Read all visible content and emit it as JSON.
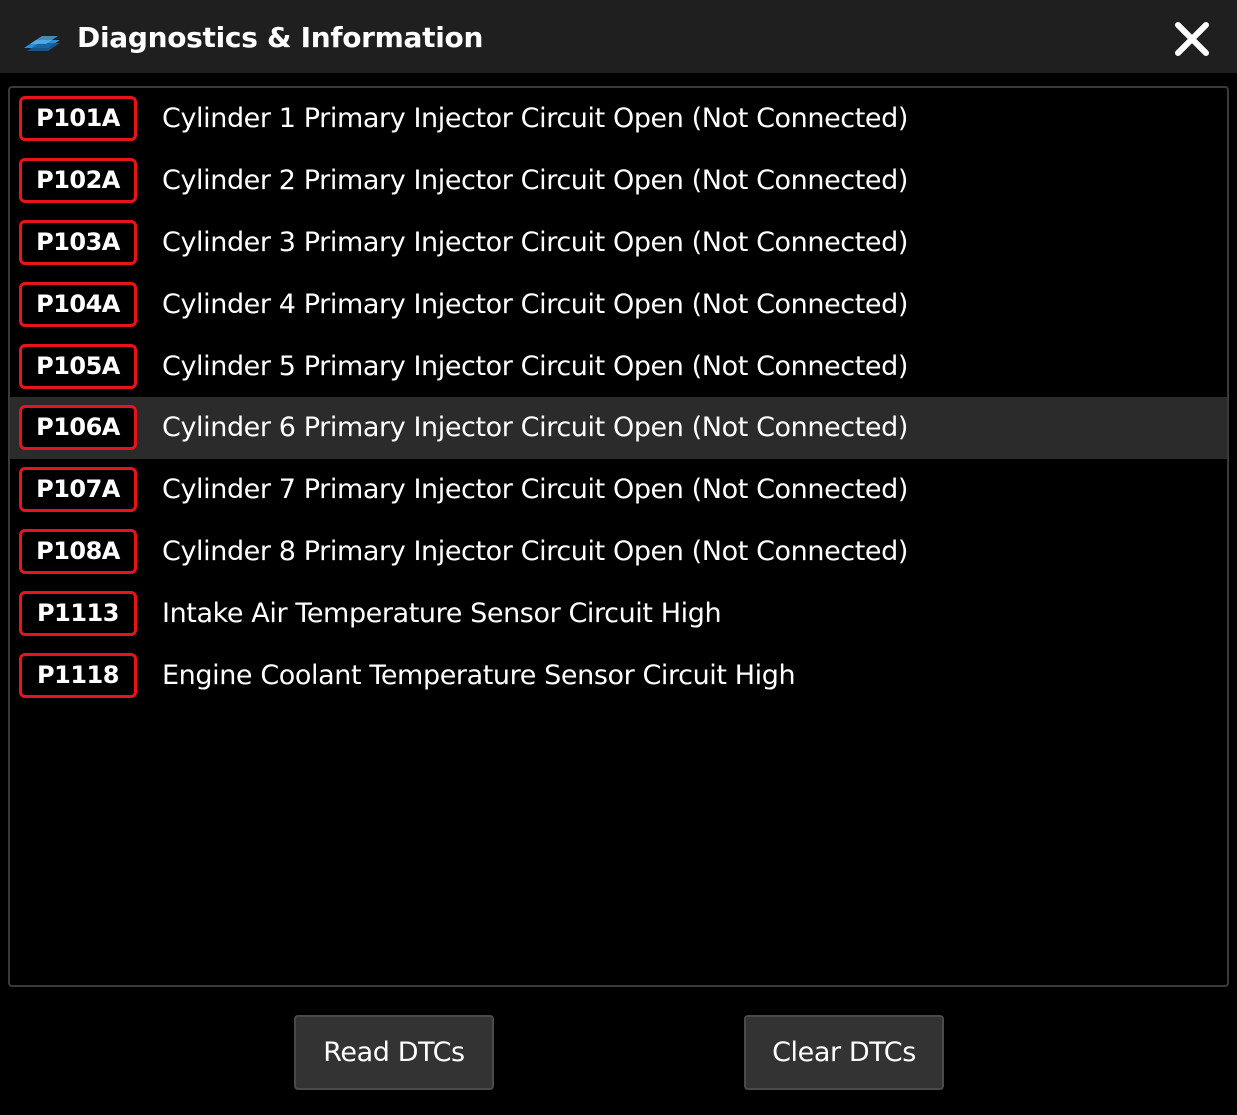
{
  "window": {
    "title": "Diagnostics & Information",
    "icon": "app-logo-icon",
    "close_icon": "close-icon"
  },
  "dtc_list": {
    "selected_index": 5,
    "items": [
      {
        "code": "P101A",
        "description": "Cylinder 1 Primary Injector Circuit Open (Not Connected)"
      },
      {
        "code": "P102A",
        "description": "Cylinder 2 Primary Injector Circuit Open (Not Connected)"
      },
      {
        "code": "P103A",
        "description": "Cylinder 3 Primary Injector Circuit Open (Not Connected)"
      },
      {
        "code": "P104A",
        "description": "Cylinder 4 Primary Injector Circuit Open (Not Connected)"
      },
      {
        "code": "P105A",
        "description": "Cylinder 5 Primary Injector Circuit Open (Not Connected)"
      },
      {
        "code": "P106A",
        "description": "Cylinder 6 Primary Injector Circuit Open (Not Connected)"
      },
      {
        "code": "P107A",
        "description": "Cylinder 7 Primary Injector Circuit Open (Not Connected)"
      },
      {
        "code": "P108A",
        "description": "Cylinder 8 Primary Injector Circuit Open (Not Connected)"
      },
      {
        "code": "P1113",
        "description": "Intake Air Temperature Sensor Circuit High"
      },
      {
        "code": "P1118",
        "description": "Engine Coolant Temperature Sensor Circuit High"
      }
    ]
  },
  "actions": {
    "read_label": "Read DTCs",
    "clear_label": "Clear DTCs"
  },
  "colors": {
    "titlebar_bg": "#1f1f1f",
    "background": "#000000",
    "code_border": "#e8141c",
    "selected_row_bg": "#2b2b2b",
    "button_bg": "#333333",
    "accent_blue": "#2a8fd8"
  }
}
